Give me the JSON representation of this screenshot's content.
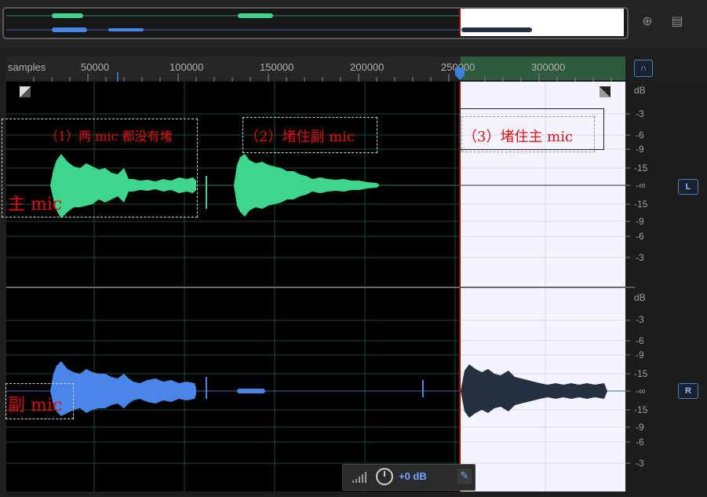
{
  "ruler": {
    "unit_label": "samples",
    "ticks": [
      "50000",
      "100000",
      "150000",
      "200000",
      "250000",
      "300000"
    ]
  },
  "channels": {
    "top": {
      "db_labels": [
        "dB",
        "-3",
        "-6",
        "-9",
        "-15",
        "-∞",
        "-15",
        "-9",
        "-6",
        "-3"
      ],
      "button": "L",
      "side_label": "主 mic"
    },
    "bottom": {
      "db_labels": [
        "dB",
        "-3",
        "-6",
        "-9",
        "-15",
        "-∞",
        "-15",
        "-9",
        "-6",
        "-3"
      ],
      "button": "R",
      "side_label": "副 mic"
    }
  },
  "annotations": {
    "a1": "（1）两 mic 都没有堵",
    "a2": "（2）堵住副 mic",
    "a3": "（3）堵住主 mic"
  },
  "hud": {
    "gain": "+0 dB"
  },
  "icons": [
    "zoom-icon",
    "list-icon",
    "headphones-icon",
    "meter-icon",
    "knob-icon",
    "pin-icon"
  ],
  "colors": {
    "top_wave": "#3dd68c",
    "bottom_wave": "#4a86e8",
    "sel_bottom_wave": "#243040",
    "playhead": "#cc0000"
  }
}
